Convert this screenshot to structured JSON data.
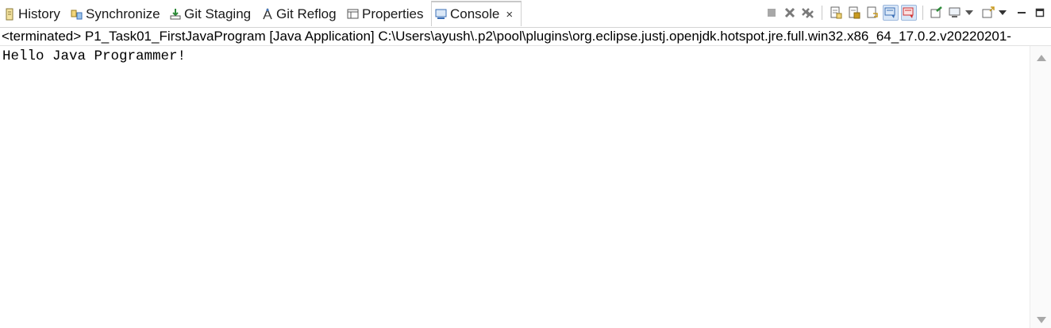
{
  "tabs": [
    {
      "label": "History",
      "icon": "history-icon"
    },
    {
      "label": "Synchronize",
      "icon": "synchronize-icon"
    },
    {
      "label": "Git Staging",
      "icon": "git-staging-icon"
    },
    {
      "label": "Git Reflog",
      "icon": "git-reflog-icon"
    },
    {
      "label": "Properties",
      "icon": "properties-icon"
    },
    {
      "label": "Console",
      "icon": "console-icon",
      "active": true,
      "close": "×"
    }
  ],
  "status": {
    "text": "<terminated> P1_Task01_FirstJavaProgram [Java Application] C:\\Users\\ayush\\.p2\\pool\\plugins\\org.eclipse.justj.openjdk.hotspot.jre.full.win32.x86_64_17.0.2.v20220201-"
  },
  "console": {
    "output": "Hello Java Programmer!"
  },
  "colors": {
    "toolbar_gray": "#8c8c8c",
    "accent_blue": "#3b6fb6",
    "accent_green": "#2e8b3a",
    "accent_red": "#d03030",
    "accent_gold": "#c89a20"
  }
}
